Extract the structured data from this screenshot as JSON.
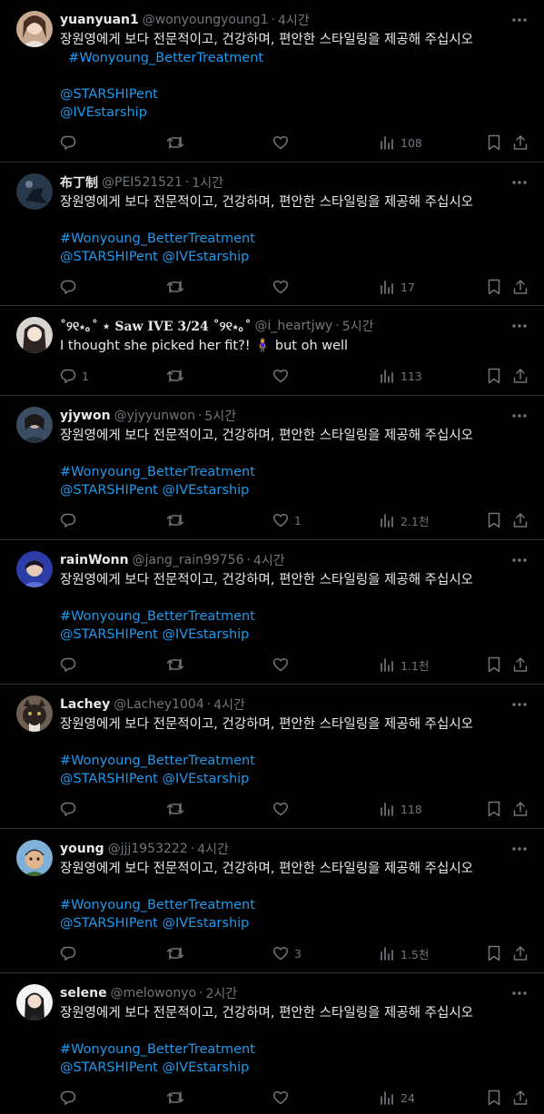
{
  "colors": {
    "background": "#000000",
    "text": "#e7e9ea",
    "muted": "#71767b",
    "link": "#1d9bf0",
    "divider": "#2f3336"
  },
  "tweets": [
    {
      "name": "yuanyuan1",
      "handle": "@wonyoungyoung1",
      "sep": "·",
      "time": "4시간",
      "lines": [
        {
          "text": "장원영에게 보다 전문적이고, 건강하며, 편안한 스타일링을 제공해 주십시오"
        },
        {
          "text": "  #Wonyoung_BetterTreatment",
          "link": true
        },
        {
          "text": ""
        },
        {
          "text": "@STARSHIPent",
          "link": true
        },
        {
          "text": "@IVEstarship",
          "link": true
        }
      ],
      "reply_count": "",
      "retweet_count": "",
      "like_count": "",
      "view_count": "108"
    },
    {
      "name": "布丁制",
      "handle": "@PEI521521",
      "sep": "·",
      "time": "1시간",
      "lines": [
        {
          "text": "장원영에게 보다 전문적이고, 건강하며, 편안한 스타일링을 제공해 주십시오"
        },
        {
          "text": ""
        },
        {
          "text": "#Wonyoung_BetterTreatment",
          "link": true
        },
        {
          "text": "@STARSHIPent @IVEstarship",
          "link": true
        }
      ],
      "reply_count": "",
      "retweet_count": "",
      "like_count": "",
      "view_count": "17"
    },
    {
      "name": "˚୨୧⋆｡˚ ⋆ Saw IVE 3/24 ˚୨୧⋆｡˚",
      "handle": "@i_heartjwy",
      "sep": "·",
      "time": "5시간",
      "lines": [
        {
          "text": "I thought she picked her fit?! 🧍‍♀️ but oh well"
        }
      ],
      "reply_count": "1",
      "retweet_count": "",
      "like_count": "",
      "view_count": "113"
    },
    {
      "name": "yjywon",
      "handle": "@yjyyunwon",
      "sep": "·",
      "time": "5시간",
      "lines": [
        {
          "text": "장원영에게 보다 전문적이고, 건강하며, 편안한 스타일링을 제공해 주십시오"
        },
        {
          "text": ""
        },
        {
          "text": "#Wonyoung_BetterTreatment",
          "link": true
        },
        {
          "text": "@STARSHIPent @IVEstarship",
          "link": true
        }
      ],
      "reply_count": "",
      "retweet_count": "",
      "like_count": "1",
      "view_count": "2.1천"
    },
    {
      "name": "rainWonn",
      "handle": "@jang_rain99756",
      "sep": "·",
      "time": "4시간",
      "lines": [
        {
          "text": "장원영에게 보다 전문적이고, 건강하며, 편안한 스타일링을 제공해 주십시오"
        },
        {
          "text": ""
        },
        {
          "text": "#Wonyoung_BetterTreatment",
          "link": true
        },
        {
          "text": "@STARSHIPent @IVEstarship",
          "link": true
        }
      ],
      "reply_count": "",
      "retweet_count": "",
      "like_count": "",
      "view_count": "1.1천"
    },
    {
      "name": "Lachey",
      "handle": "@Lachey1004",
      "sep": "·",
      "time": "4시간",
      "lines": [
        {
          "text": "장원영에게 보다 전문적이고, 건강하며, 편안한 스타일링을 제공해 주십시오"
        },
        {
          "text": ""
        },
        {
          "text": "#Wonyoung_BetterTreatment",
          "link": true
        },
        {
          "text": "@STARSHIPent @IVEstarship",
          "link": true
        }
      ],
      "reply_count": "",
      "retweet_count": "",
      "like_count": "",
      "view_count": "118"
    },
    {
      "name": "young",
      "handle": "@jjj1953222",
      "sep": "·",
      "time": "4시간",
      "lines": [
        {
          "text": "장원영에게 보다 전문적이고, 건강하며, 편안한 스타일링을 제공해 주십시오"
        },
        {
          "text": ""
        },
        {
          "text": "#Wonyoung_BetterTreatment",
          "link": true
        },
        {
          "text": "@STARSHIPent @IVEstarship",
          "link": true
        }
      ],
      "reply_count": "",
      "retweet_count": "",
      "like_count": "3",
      "view_count": "1.5천"
    },
    {
      "name": "selene",
      "handle": "@melowonyo",
      "sep": "·",
      "time": "2시간",
      "lines": [
        {
          "text": "장원영에게 보다 전문적이고, 건강하며, 편안한 스타일링을 제공해 주십시오"
        },
        {
          "text": ""
        },
        {
          "text": "#Wonyoung_BetterTreatment",
          "link": true
        },
        {
          "text": "@STARSHIPent @IVEstarship",
          "link": true
        }
      ],
      "reply_count": "",
      "retweet_count": "",
      "like_count": "",
      "view_count": "24"
    }
  ]
}
